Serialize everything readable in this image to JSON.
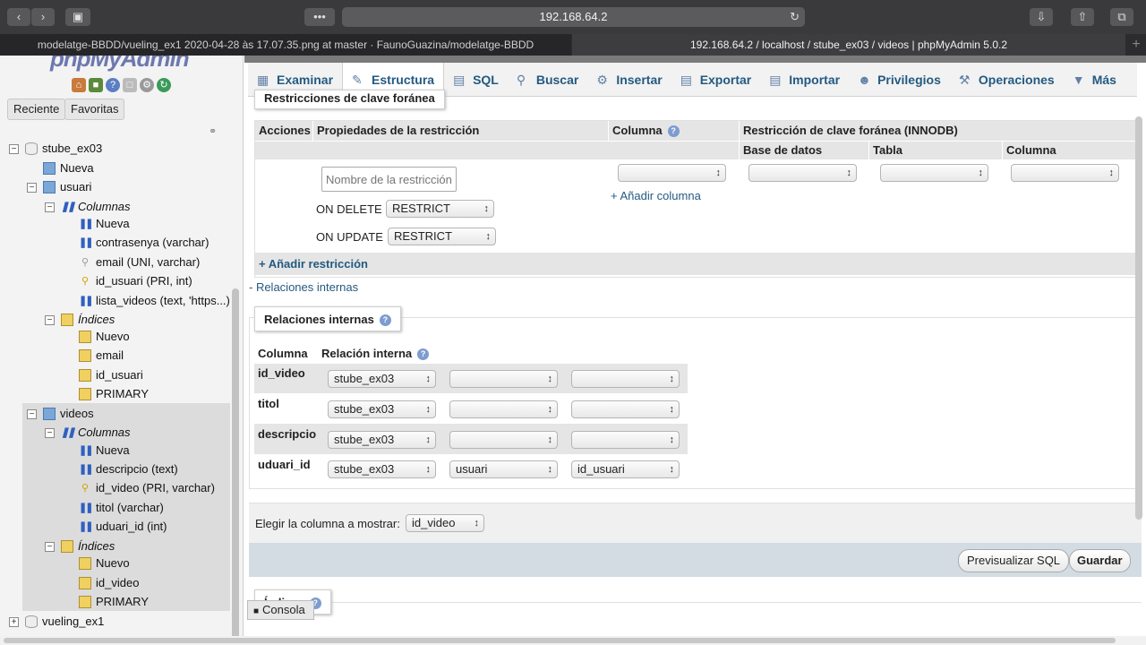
{
  "browser": {
    "url": "192.168.64.2",
    "tabs": [
      {
        "title": "modelatge-BBDD/vueling_ex1 2020-04-28 às 17.07.35.png at master · FaunoGuazina/modelatge-BBDD"
      },
      {
        "title": "192.168.64.2 / localhost / stube_ex03 / videos | phpMyAdmin 5.0.2"
      }
    ],
    "new_tab": "+"
  },
  "sidebar": {
    "logo": "phpMyAdmin",
    "buttons": {
      "recent": "Reciente",
      "favorites": "Favoritas"
    },
    "tree": {
      "db": "stube_ex03",
      "new_table": "Nueva",
      "usuari": {
        "name": "usuari",
        "columns_label": "Columnas",
        "columns": [
          "Nueva",
          "contrasenya (varchar)",
          "email (UNI, varchar)",
          "id_usuari (PRI, int)",
          "lista_videos (text, 'https...)"
        ],
        "indexes_label": "Índices",
        "indexes": [
          "Nuevo",
          "email",
          "id_usuari",
          "PRIMARY"
        ]
      },
      "videos": {
        "name": "videos",
        "columns_label": "Columnas",
        "columns": [
          "Nueva",
          "descripcio (text)",
          "id_video (PRI, varchar)",
          "titol (varchar)",
          "uduari_id (int)"
        ],
        "indexes_label": "Índices",
        "indexes": [
          "Nuevo",
          "id_video",
          "PRIMARY"
        ]
      },
      "other_db": "vueling_ex1"
    }
  },
  "menu": {
    "tabs": [
      "Examinar",
      "Estructura",
      "SQL",
      "Buscar",
      "Insertar",
      "Exportar",
      "Importar",
      "Privilegios",
      "Operaciones",
      "Más"
    ],
    "active": "Estructura"
  },
  "foreign": {
    "legend": "Restricciones de clave foránea",
    "headers": {
      "actions": "Acciones",
      "props": "Propiedades de la restricción",
      "column": "Columna",
      "fk": "Restricción de clave foránea (INNODB)",
      "database": "Base de datos",
      "table": "Tabla",
      "fk_column": "Columna"
    },
    "name_placeholder": "Nombre de la restricción",
    "on_delete_label": "ON DELETE",
    "on_delete_value": "RESTRICT",
    "on_update_label": "ON UPDATE",
    "on_update_value": "RESTRICT",
    "add_column": "+ Añadir columna",
    "add_constraint": "+ Añadir restricción"
  },
  "internal": {
    "toggle_link": "- Relaciones internas",
    "legend": "Relaciones internas",
    "headers": {
      "column": "Columna",
      "relation": "Relación interna"
    },
    "rows": [
      {
        "column": "id_video",
        "db": "stube_ex03",
        "table": "",
        "col": ""
      },
      {
        "column": "titol",
        "db": "stube_ex03",
        "table": "",
        "col": ""
      },
      {
        "column": "descripcio",
        "db": "stube_ex03",
        "table": "",
        "col": ""
      },
      {
        "column": "uduari_id",
        "db": "stube_ex03",
        "table": "usuari",
        "col": "id_usuari"
      }
    ]
  },
  "display": {
    "label": "Elegir la columna a mostrar:",
    "value": "id_video"
  },
  "actions": {
    "preview": "Previsualizar SQL",
    "save": "Guardar"
  },
  "console": {
    "label": "Consola"
  },
  "indexes_legend": "Índices"
}
